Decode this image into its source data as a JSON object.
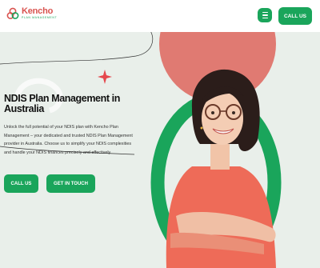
{
  "header": {
    "logo_name": "Kencho",
    "logo_tagline": "PLAN MANAGEMENT",
    "menu_icon": "hamburger-icon",
    "call_label": "CALL US"
  },
  "hero": {
    "title": "NDIS Plan Management in Australia",
    "description": "Unlock the full potential of your NDIS plan with Kencho Plan Management – your dedicated and trusted NDIS Plan Management provider in Australia. Choose us to simplify your NDIS complexities and handle your NDIS finances precisely and effectively.",
    "call_button": "CALL US",
    "touch_button": "GET IN TOUCH",
    "image_description": "Smiling woman with glasses in red t-shirt, arms crossed"
  },
  "colors": {
    "brand_green": "#1aa55b",
    "brand_red": "#d9534f",
    "coral": "#e07a72",
    "background": "#e9efea"
  }
}
